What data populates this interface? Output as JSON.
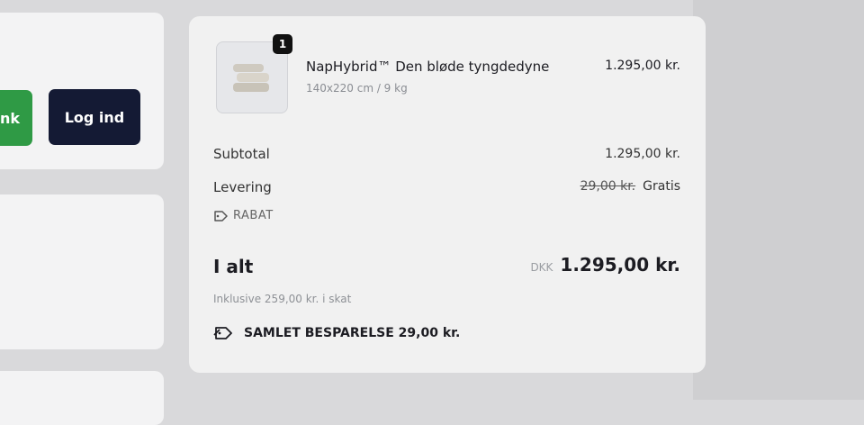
{
  "header": {
    "left_button_label": "nk",
    "login_label": "Log ind"
  },
  "cart": {
    "item": {
      "quantity": "1",
      "name": "NapHybrid™ Den bløde tyngdedyne",
      "variant": "140x220 cm / 9 kg",
      "price": "1.295,00 kr."
    },
    "summary": {
      "subtotal_label": "Subtotal",
      "subtotal_value": "1.295,00 kr.",
      "shipping_label": "Levering",
      "shipping_original": "29,00 kr.",
      "shipping_value": "Gratis",
      "discount_label": "RABAT",
      "total_label": "I alt",
      "total_currency": "DKK",
      "total_value": "1.295,00 kr.",
      "tax_note": "Inklusive 259,00 kr. i skat",
      "savings_text": "SAMLET BESPARELSE 29,00 kr."
    }
  },
  "colors": {
    "login_button": "#141a34",
    "green_button": "#2f9a45",
    "panel_bg": "#f1f1f1"
  }
}
